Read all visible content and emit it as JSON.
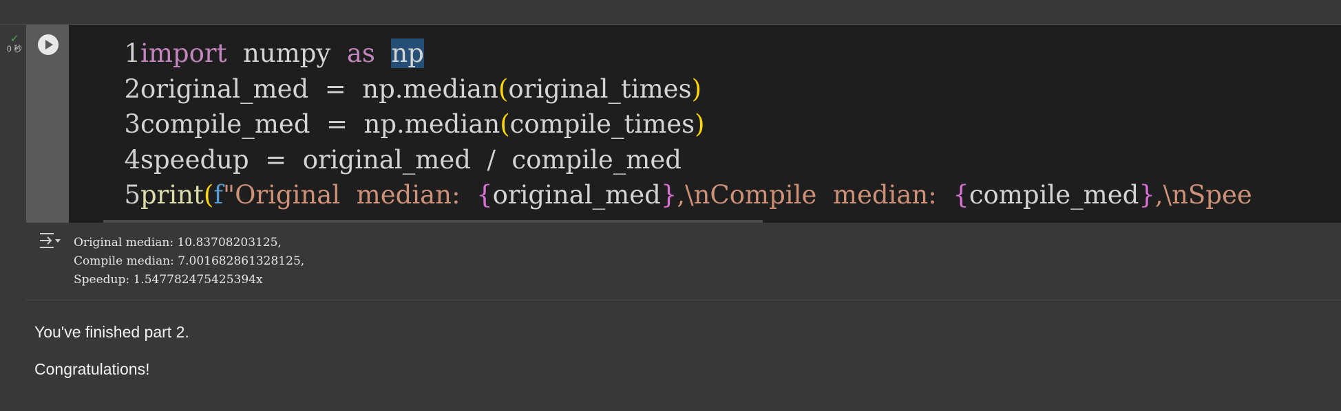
{
  "cell": {
    "status_time": "0 秒",
    "code_lines": [
      {
        "num": "1",
        "t1": "import",
        "t2": "  numpy  ",
        "t3": "as",
        "t4": "  ",
        "t5": "np"
      },
      {
        "num": "2",
        "t1": "original_med  =  np.median",
        "t2": "(",
        "t3": "original_times",
        "t4": ")"
      },
      {
        "num": "3",
        "t1": "compile_med  =  np.median",
        "t2": "(",
        "t3": "compile_times",
        "t4": ")"
      },
      {
        "num": "4",
        "t1": "speedup  =  original_med  /  compile_med"
      },
      {
        "num": "5",
        "t1": "print",
        "t2": "(",
        "t3": "f",
        "t4": "\"Original  median:  ",
        "t5": "{",
        "t6": "original_med",
        "t7": "}",
        "t8": ",\\nCompile  median:  ",
        "t9": "{",
        "t10": "compile_med",
        "t11": "}",
        "t12": ",\\nSpee"
      }
    ],
    "output_lines": [
      "Original median: 10.83708203125,",
      "Compile median: 7.001682861328125,",
      "Speedup: 1.547782475425394x"
    ]
  },
  "markdown": {
    "line1": "You've finished part 2.",
    "line2": "Congratulations!"
  }
}
